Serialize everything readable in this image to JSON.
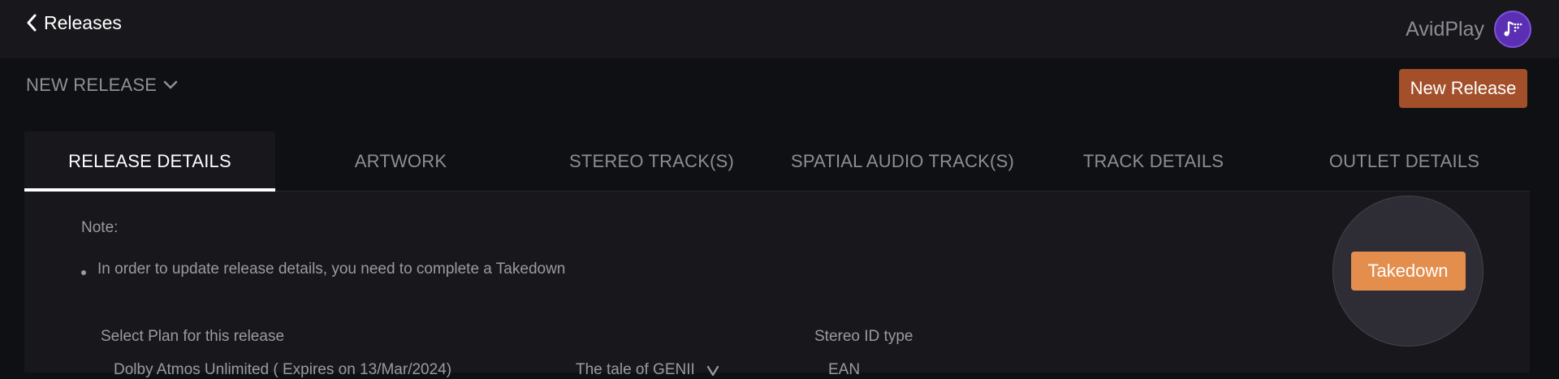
{
  "header": {
    "back_label": "Releases",
    "brand_name": "AvidPlay",
    "brand_color": "#5b2fb4"
  },
  "subheader": {
    "dropdown_label": "NEW RELEASE",
    "new_release_button": "New Release",
    "accent_color": "#a24f2a"
  },
  "tabs": [
    {
      "label": "RELEASE DETAILS",
      "active": true
    },
    {
      "label": "ARTWORK",
      "active": false
    },
    {
      "label": "STEREO TRACK(S)",
      "active": false
    },
    {
      "label": "SPATIAL AUDIO TRACK(S)",
      "active": false
    },
    {
      "label": "TRACK DETAILS",
      "active": false
    },
    {
      "label": "OUTLET DETAILS",
      "active": false
    }
  ],
  "note": {
    "title": "Note:",
    "items": [
      "In order to update release details, you need to complete a Takedown"
    ]
  },
  "takedown_button": "Takedown",
  "takedown_color": "#e48e4e",
  "form": {
    "plan_label": "Select Plan for this release",
    "plan_value": "Dolby Atmos Unlimited ( Expires on 13/Mar/2024)",
    "plan_release_name": "The tale of GENII",
    "stereo_id_label": "Stereo ID type",
    "stereo_id_value": "EAN"
  }
}
